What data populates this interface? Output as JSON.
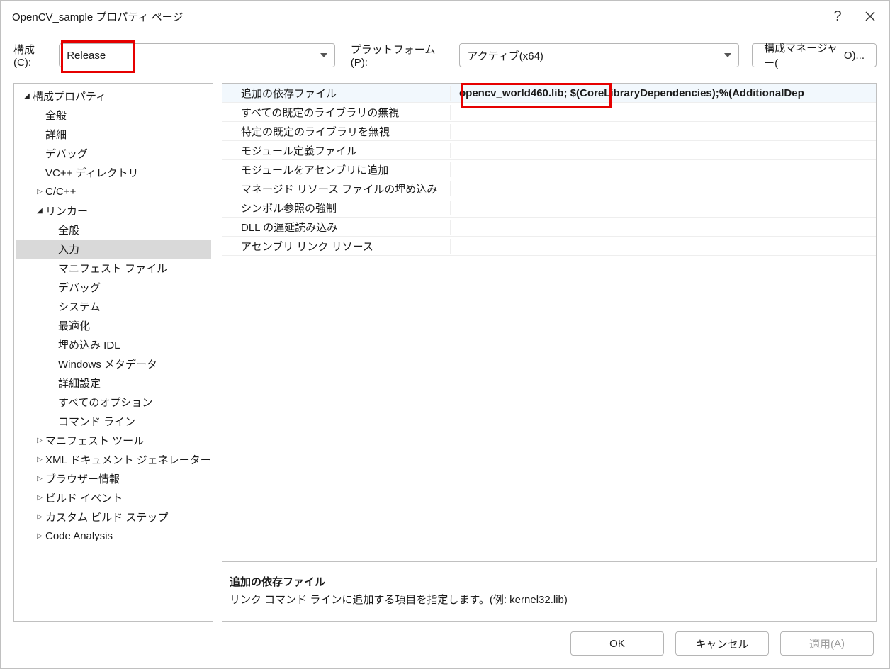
{
  "title": "OpenCV_sample プロパティ ページ",
  "toolbar": {
    "config_label_pre": "構成(",
    "config_label_key": "C",
    "config_label_post": "):",
    "config_value": "Release",
    "platform_label_pre": "プラットフォーム(",
    "platform_label_key": "P",
    "platform_label_post": "):",
    "platform_value": "アクティブ(x64)",
    "cfgmgr_pre": "構成マネージャー(",
    "cfgmgr_key": "O",
    "cfgmgr_post": ")..."
  },
  "tree": [
    {
      "level": 0,
      "arrow": "open",
      "label": "構成プロパティ"
    },
    {
      "level": 1,
      "arrow": "",
      "label": "全般"
    },
    {
      "level": 1,
      "arrow": "",
      "label": "詳細"
    },
    {
      "level": 1,
      "arrow": "",
      "label": "デバッグ"
    },
    {
      "level": 1,
      "arrow": "",
      "label": "VC++ ディレクトリ"
    },
    {
      "level": 1,
      "arrow": "closed",
      "label": "C/C++"
    },
    {
      "level": 1,
      "arrow": "open",
      "label": "リンカー"
    },
    {
      "level": 2,
      "arrow": "",
      "label": "全般"
    },
    {
      "level": 2,
      "arrow": "",
      "label": "入力",
      "selected": true
    },
    {
      "level": 2,
      "arrow": "",
      "label": "マニフェスト ファイル"
    },
    {
      "level": 2,
      "arrow": "",
      "label": "デバッグ"
    },
    {
      "level": 2,
      "arrow": "",
      "label": "システム"
    },
    {
      "level": 2,
      "arrow": "",
      "label": "最適化"
    },
    {
      "level": 2,
      "arrow": "",
      "label": "埋め込み IDL"
    },
    {
      "level": 2,
      "arrow": "",
      "label": "Windows メタデータ"
    },
    {
      "level": 2,
      "arrow": "",
      "label": "詳細設定"
    },
    {
      "level": 2,
      "arrow": "",
      "label": "すべてのオプション"
    },
    {
      "level": 2,
      "arrow": "",
      "label": "コマンド ライン"
    },
    {
      "level": 1,
      "arrow": "closed",
      "label": "マニフェスト ツール"
    },
    {
      "level": 1,
      "arrow": "closed",
      "label": "XML ドキュメント ジェネレーター"
    },
    {
      "level": 1,
      "arrow": "closed",
      "label": "ブラウザー情報"
    },
    {
      "level": 1,
      "arrow": "closed",
      "label": "ビルド イベント"
    },
    {
      "level": 1,
      "arrow": "closed",
      "label": "カスタム ビルド ステップ"
    },
    {
      "level": 1,
      "arrow": "closed",
      "label": "Code Analysis"
    }
  ],
  "props": [
    {
      "label": "追加の依存ファイル",
      "value": "opencv_world460.lib; $(CoreLibraryDependencies);%(AdditionalDep",
      "selected": true
    },
    {
      "label": "すべての既定のライブラリの無視",
      "value": ""
    },
    {
      "label": "特定の既定のライブラリを無視",
      "value": ""
    },
    {
      "label": "モジュール定義ファイル",
      "value": ""
    },
    {
      "label": "モジュールをアセンブリに追加",
      "value": ""
    },
    {
      "label": "マネージド リソース ファイルの埋め込み",
      "value": ""
    },
    {
      "label": "シンボル参照の強制",
      "value": ""
    },
    {
      "label": "DLL の遅延読み込み",
      "value": ""
    },
    {
      "label": "アセンブリ リンク リソース",
      "value": ""
    }
  ],
  "desc": {
    "title": "追加の依存ファイル",
    "text": "リンク コマンド ラインに追加する項目を指定します。(例: kernel32.lib)"
  },
  "footer": {
    "ok": "OK",
    "cancel": "キャンセル",
    "apply_pre": "適用(",
    "apply_key": "A",
    "apply_post": ")"
  }
}
